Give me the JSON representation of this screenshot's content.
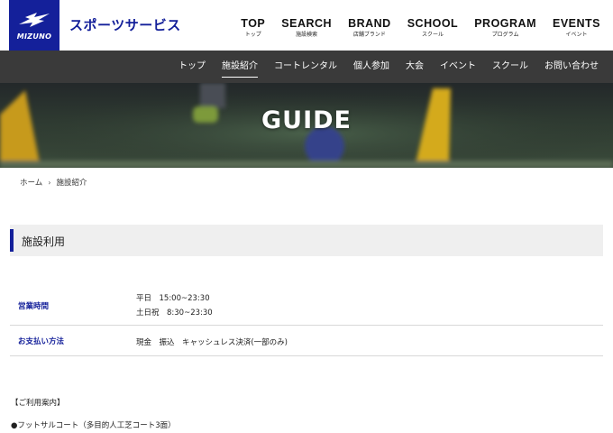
{
  "header": {
    "logo_text": "MIZUNO",
    "site_title": "スポーツサービス",
    "brand_color": "#14209a",
    "nav": [
      {
        "main": "TOP",
        "sub": "トップ"
      },
      {
        "main": "SEARCH",
        "sub": "施設検索"
      },
      {
        "main": "BRAND",
        "sub": "店舗ブランド"
      },
      {
        "main": "SCHOOL",
        "sub": "スクール"
      },
      {
        "main": "PROGRAM",
        "sub": "プログラム"
      },
      {
        "main": "EVENTS",
        "sub": "イベント"
      }
    ]
  },
  "sub_nav": {
    "items": [
      "トップ",
      "施設紹介",
      "コートレンタル",
      "個人参加",
      "大会",
      "イベント",
      "スクール",
      "お問い合わせ"
    ],
    "active": "施設紹介"
  },
  "hero": {
    "title": "GUIDE"
  },
  "breadcrumb": {
    "home": "ホーム",
    "separator": "›",
    "current": "施設紹介"
  },
  "section": {
    "title": "施設利用"
  },
  "info": {
    "hours_label": "営業時間",
    "hours_lines": [
      "平日　15:00~23:30",
      "土日祝　8:30~23:30"
    ],
    "payment_label": "お支払い方法",
    "payment_value": "現金　振込　キャッシュレス決済(一部のみ)"
  },
  "notes": {
    "heading": "【ご利用案内】",
    "item1": "●フットサルコート（多目的人工芝コート3面）"
  }
}
